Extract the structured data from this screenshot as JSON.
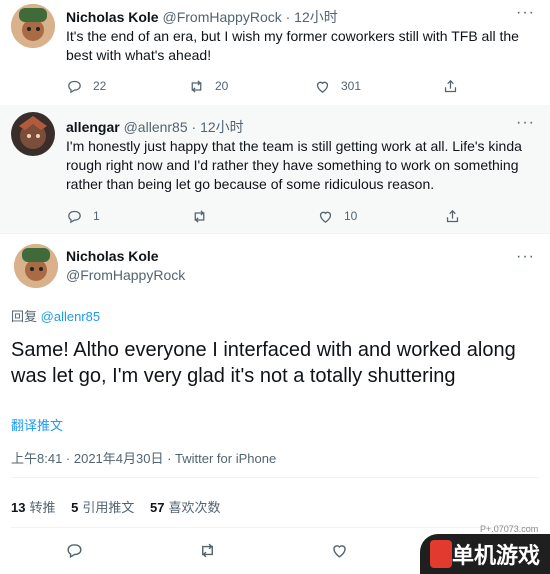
{
  "tweets": [
    {
      "name": "Nicholas Kole",
      "handle": "@FromHappyRock",
      "time": "· 12小时",
      "text": "It's the end of an era, but I wish my former coworkers still with TFB all the best with what's ahead!",
      "replies": "22",
      "retweets": "20",
      "likes": "301"
    },
    {
      "name": "allengar",
      "handle": "@allenr85",
      "time": "· 12小时",
      "text": "I'm honestly just happy that the team is still getting work at all. Life's kinda rough right now and I'd rather they have something to work on something rather than being let go because of some ridiculous reason.",
      "replies": "1",
      "retweets": "",
      "likes": "10"
    }
  ],
  "main_tweet": {
    "name": "Nicholas Kole",
    "handle": "@FromHappyRock",
    "reply_prefix": "回复",
    "reply_to": "@allenr85",
    "text": "Same! Altho everyone I interfaced with and worked along was let go, I'm very glad it's not a totally shuttering",
    "translate": "翻译推文",
    "meta": "上午8:41 · 2021年4月30日 · Twitter for iPhone",
    "stats": [
      {
        "num": "13",
        "label": "转推"
      },
      {
        "num": "5",
        "label": "引用推文"
      },
      {
        "num": "57",
        "label": "喜欢次数"
      }
    ]
  },
  "watermark": {
    "text": "单机游戏",
    "url": "P+.07073.com"
  },
  "colors": {
    "accent": "#1d9bf0",
    "muted": "#536471",
    "text": "#0f1419",
    "highlight_bg": "#f7f9f9"
  },
  "icons": [
    "more-icon",
    "reply-icon",
    "retweet-icon",
    "like-icon",
    "share-icon"
  ]
}
